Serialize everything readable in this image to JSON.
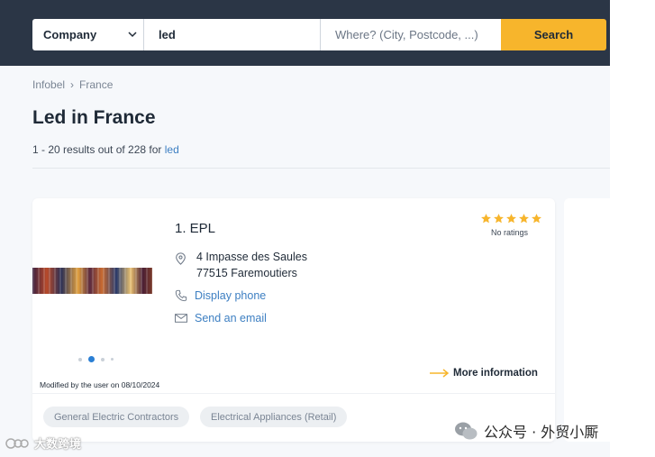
{
  "search": {
    "company_select": "Company",
    "what_value": "led",
    "where_placeholder": "Where? (City, Postcode, ...)",
    "search_label": "Search"
  },
  "breadcrumb": [
    "Infobel",
    "France"
  ],
  "title": "Led in France",
  "results": {
    "prefix": "1 - 20 results out of 228 for ",
    "query": "led"
  },
  "listing": {
    "name": "1. EPL",
    "rating_stars": 5,
    "rating_text": "No ratings",
    "address_line1": "4 Impasse des Saules",
    "address_line2": "77515 Faremoutiers",
    "phone_label": "Display phone",
    "email_label": "Send an email",
    "more_info_label": "More information",
    "modified_text": "Modified by the user on 08/10/2024",
    "tags": [
      "General Electric Contractors",
      "Electrical Appliances (Retail)"
    ]
  },
  "colors": {
    "header_bg": "#2b3646",
    "accent": "#f7b52c",
    "link": "#3d7fc2"
  },
  "watermarks": {
    "right": "公众号 · 外贸小厮",
    "left": "大数跨境"
  }
}
